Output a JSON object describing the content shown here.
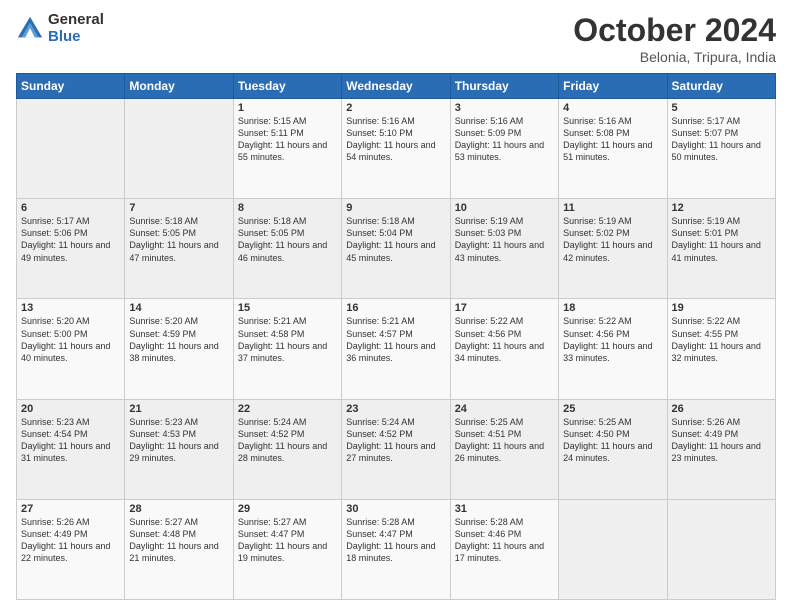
{
  "logo": {
    "general": "General",
    "blue": "Blue"
  },
  "title": "October 2024",
  "location": "Belonia, Tripura, India",
  "days_of_week": [
    "Sunday",
    "Monday",
    "Tuesday",
    "Wednesday",
    "Thursday",
    "Friday",
    "Saturday"
  ],
  "weeks": [
    [
      {
        "day": "",
        "empty": true
      },
      {
        "day": "",
        "empty": true
      },
      {
        "day": "1",
        "sunrise": "Sunrise: 5:15 AM",
        "sunset": "Sunset: 5:11 PM",
        "daylight": "Daylight: 11 hours and 55 minutes."
      },
      {
        "day": "2",
        "sunrise": "Sunrise: 5:16 AM",
        "sunset": "Sunset: 5:10 PM",
        "daylight": "Daylight: 11 hours and 54 minutes."
      },
      {
        "day": "3",
        "sunrise": "Sunrise: 5:16 AM",
        "sunset": "Sunset: 5:09 PM",
        "daylight": "Daylight: 11 hours and 53 minutes."
      },
      {
        "day": "4",
        "sunrise": "Sunrise: 5:16 AM",
        "sunset": "Sunset: 5:08 PM",
        "daylight": "Daylight: 11 hours and 51 minutes."
      },
      {
        "day": "5",
        "sunrise": "Sunrise: 5:17 AM",
        "sunset": "Sunset: 5:07 PM",
        "daylight": "Daylight: 11 hours and 50 minutes."
      }
    ],
    [
      {
        "day": "6",
        "sunrise": "Sunrise: 5:17 AM",
        "sunset": "Sunset: 5:06 PM",
        "daylight": "Daylight: 11 hours and 49 minutes."
      },
      {
        "day": "7",
        "sunrise": "Sunrise: 5:18 AM",
        "sunset": "Sunset: 5:05 PM",
        "daylight": "Daylight: 11 hours and 47 minutes."
      },
      {
        "day": "8",
        "sunrise": "Sunrise: 5:18 AM",
        "sunset": "Sunset: 5:05 PM",
        "daylight": "Daylight: 11 hours and 46 minutes."
      },
      {
        "day": "9",
        "sunrise": "Sunrise: 5:18 AM",
        "sunset": "Sunset: 5:04 PM",
        "daylight": "Daylight: 11 hours and 45 minutes."
      },
      {
        "day": "10",
        "sunrise": "Sunrise: 5:19 AM",
        "sunset": "Sunset: 5:03 PM",
        "daylight": "Daylight: 11 hours and 43 minutes."
      },
      {
        "day": "11",
        "sunrise": "Sunrise: 5:19 AM",
        "sunset": "Sunset: 5:02 PM",
        "daylight": "Daylight: 11 hours and 42 minutes."
      },
      {
        "day": "12",
        "sunrise": "Sunrise: 5:19 AM",
        "sunset": "Sunset: 5:01 PM",
        "daylight": "Daylight: 11 hours and 41 minutes."
      }
    ],
    [
      {
        "day": "13",
        "sunrise": "Sunrise: 5:20 AM",
        "sunset": "Sunset: 5:00 PM",
        "daylight": "Daylight: 11 hours and 40 minutes."
      },
      {
        "day": "14",
        "sunrise": "Sunrise: 5:20 AM",
        "sunset": "Sunset: 4:59 PM",
        "daylight": "Daylight: 11 hours and 38 minutes."
      },
      {
        "day": "15",
        "sunrise": "Sunrise: 5:21 AM",
        "sunset": "Sunset: 4:58 PM",
        "daylight": "Daylight: 11 hours and 37 minutes."
      },
      {
        "day": "16",
        "sunrise": "Sunrise: 5:21 AM",
        "sunset": "Sunset: 4:57 PM",
        "daylight": "Daylight: 11 hours and 36 minutes."
      },
      {
        "day": "17",
        "sunrise": "Sunrise: 5:22 AM",
        "sunset": "Sunset: 4:56 PM",
        "daylight": "Daylight: 11 hours and 34 minutes."
      },
      {
        "day": "18",
        "sunrise": "Sunrise: 5:22 AM",
        "sunset": "Sunset: 4:56 PM",
        "daylight": "Daylight: 11 hours and 33 minutes."
      },
      {
        "day": "19",
        "sunrise": "Sunrise: 5:22 AM",
        "sunset": "Sunset: 4:55 PM",
        "daylight": "Daylight: 11 hours and 32 minutes."
      }
    ],
    [
      {
        "day": "20",
        "sunrise": "Sunrise: 5:23 AM",
        "sunset": "Sunset: 4:54 PM",
        "daylight": "Daylight: 11 hours and 31 minutes."
      },
      {
        "day": "21",
        "sunrise": "Sunrise: 5:23 AM",
        "sunset": "Sunset: 4:53 PM",
        "daylight": "Daylight: 11 hours and 29 minutes."
      },
      {
        "day": "22",
        "sunrise": "Sunrise: 5:24 AM",
        "sunset": "Sunset: 4:52 PM",
        "daylight": "Daylight: 11 hours and 28 minutes."
      },
      {
        "day": "23",
        "sunrise": "Sunrise: 5:24 AM",
        "sunset": "Sunset: 4:52 PM",
        "daylight": "Daylight: 11 hours and 27 minutes."
      },
      {
        "day": "24",
        "sunrise": "Sunrise: 5:25 AM",
        "sunset": "Sunset: 4:51 PM",
        "daylight": "Daylight: 11 hours and 26 minutes."
      },
      {
        "day": "25",
        "sunrise": "Sunrise: 5:25 AM",
        "sunset": "Sunset: 4:50 PM",
        "daylight": "Daylight: 11 hours and 24 minutes."
      },
      {
        "day": "26",
        "sunrise": "Sunrise: 5:26 AM",
        "sunset": "Sunset: 4:49 PM",
        "daylight": "Daylight: 11 hours and 23 minutes."
      }
    ],
    [
      {
        "day": "27",
        "sunrise": "Sunrise: 5:26 AM",
        "sunset": "Sunset: 4:49 PM",
        "daylight": "Daylight: 11 hours and 22 minutes."
      },
      {
        "day": "28",
        "sunrise": "Sunrise: 5:27 AM",
        "sunset": "Sunset: 4:48 PM",
        "daylight": "Daylight: 11 hours and 21 minutes."
      },
      {
        "day": "29",
        "sunrise": "Sunrise: 5:27 AM",
        "sunset": "Sunset: 4:47 PM",
        "daylight": "Daylight: 11 hours and 19 minutes."
      },
      {
        "day": "30",
        "sunrise": "Sunrise: 5:28 AM",
        "sunset": "Sunset: 4:47 PM",
        "daylight": "Daylight: 11 hours and 18 minutes."
      },
      {
        "day": "31",
        "sunrise": "Sunrise: 5:28 AM",
        "sunset": "Sunset: 4:46 PM",
        "daylight": "Daylight: 11 hours and 17 minutes."
      },
      {
        "day": "",
        "empty": true
      },
      {
        "day": "",
        "empty": true
      }
    ]
  ]
}
